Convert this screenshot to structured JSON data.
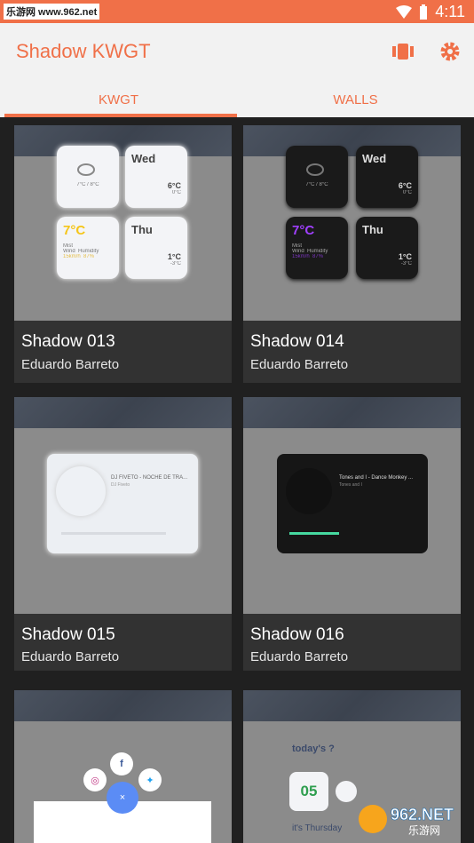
{
  "status": {
    "watermark": "乐游网 www.962.net",
    "time": "4:11"
  },
  "appbar": {
    "title": "Shadow KWGT",
    "icons": [
      "collection-icon",
      "settings-icon"
    ]
  },
  "tabs": [
    {
      "label": "KWGT",
      "active": true
    },
    {
      "label": "WALLS",
      "active": false
    }
  ],
  "cards": [
    {
      "name": "Shadow 013",
      "author": "Eduardo Barreto",
      "preview": {
        "t1": "7°C / 8°C",
        "day1": "Wed",
        "d1temp": "6°C",
        "d1low": "0°C",
        "temp": "7°C",
        "mist": "Mist",
        "wind": "Wind",
        "humidity": "Humidity",
        "windv": "15km/h",
        "humv": "87%",
        "day2": "Thu",
        "d2temp": "1°C",
        "d2low": "-3°C"
      }
    },
    {
      "name": "Shadow 014",
      "author": "Eduardo Barreto",
      "preview": {
        "t1": "7°C / 8°C",
        "day1": "Wed",
        "d1temp": "6°C",
        "d1low": "0°C",
        "temp": "7°C",
        "mist": "Mist",
        "wind": "Wind",
        "humidity": "Humidity",
        "windv": "15km/h",
        "humv": "87%",
        "day2": "Thu",
        "d2temp": "1°C",
        "d2low": "-3°C"
      }
    },
    {
      "name": "Shadow 015",
      "author": "Eduardo Barreto",
      "preview": {
        "track": "DJ FIVETO - NOCHE DE TRA...",
        "artist": "DJ Fiveto"
      }
    },
    {
      "name": "Shadow 016",
      "author": "Eduardo Barreto",
      "preview": {
        "track": "Tones and I - Dance Monkey ...",
        "artist": "Tones and I"
      }
    },
    {
      "name": "",
      "author": "",
      "preview": {
        "center": "×"
      }
    },
    {
      "name": "",
      "author": "",
      "preview": {
        "q": "today's ?",
        "date": "05",
        "bottom": "it's Thursday"
      }
    }
  ],
  "watermark2": {
    "text": "962.NET",
    "sub": "乐游网"
  },
  "colors": {
    "accent": "#f07048",
    "bg": "#202020",
    "card": "#323232"
  }
}
